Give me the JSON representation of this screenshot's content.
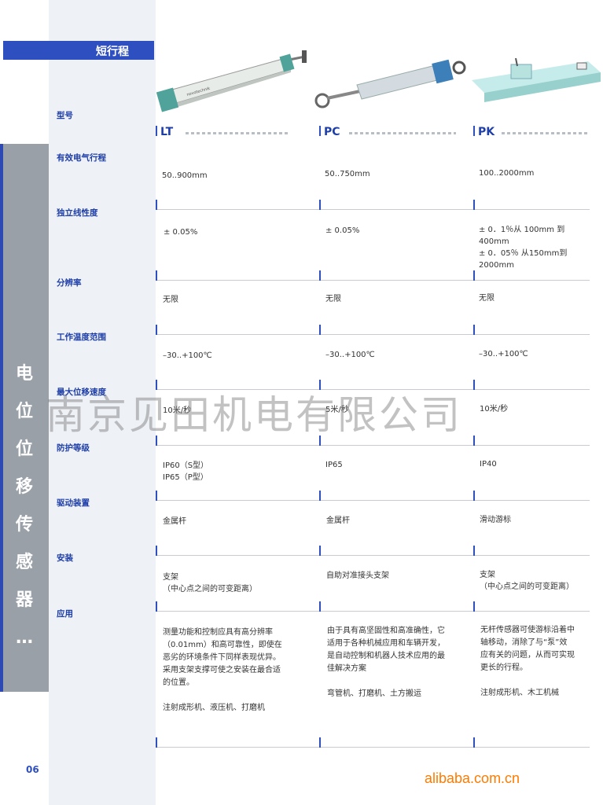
{
  "header": {
    "title": "短行程"
  },
  "sidebar": {
    "vertical_title": [
      "电",
      "位",
      "位",
      "移",
      "传",
      "感",
      "器",
      "…"
    ]
  },
  "columns": [
    {
      "name": "LT",
      "color": "#2e4fbf"
    },
    {
      "name": "PC",
      "color": "#2e4fbf"
    },
    {
      "name": "PK",
      "color": "#2e4fbf"
    }
  ],
  "rows": [
    {
      "label": "型号"
    },
    {
      "label": "有效电气行程",
      "values": [
        "50..900mm",
        "50..750mm",
        "100..2000mm"
      ]
    },
    {
      "label": "独立线性度",
      "values": [
        [
          "± 0.05%"
        ],
        [
          "± 0.05%"
        ],
        [
          "± 0．1％从  100mm  到",
          "400mm",
          "± 0．05％  从150mm到",
          "2000mm"
        ]
      ]
    },
    {
      "label": "分辨率",
      "values": [
        "无限",
        "无限",
        "无限"
      ]
    },
    {
      "label": "工作温度范围",
      "values": [
        "–30..+100℃",
        "–30..+100℃",
        "–30..+100℃"
      ]
    },
    {
      "label": "最大位移速度",
      "values": [
        "10米/秒",
        "5米/秒",
        "10米/秒"
      ]
    },
    {
      "label": "防护等级",
      "values": [
        [
          "IP60（S型）",
          "IP65（P型）"
        ],
        [
          "IP65"
        ],
        [
          "IP40"
        ]
      ]
    },
    {
      "label": "驱动装置",
      "values": [
        "金属杆",
        "金属杆",
        "滑动游标"
      ]
    },
    {
      "label": "安装",
      "values": [
        [
          "支架",
          "（中心点之间的可变距离）"
        ],
        [
          "自助对准接头支架"
        ],
        [
          "支架",
          "（中心点之间的可变距离）"
        ]
      ]
    },
    {
      "label": "应用",
      "values": [
        [
          "测量功能和控制应具有高分辨率",
          "（0.01mm）和高可靠性，即使在",
          "恶劣的环境条件下同样表现优异。",
          "采用支架支撑可使之安装在最合适",
          "的位置。",
          "",
          "注射成形机、液压机、打磨机"
        ],
        [
          "由于具有高坚固性和高准确性，它",
          "适用于各种机械应用和车辆开发，",
          "是自动控制和机器人技术应用的最",
          "佳解决方案",
          "",
          "弯管机、打磨机、土方搬运"
        ],
        [
          "无杆传感器可使游标沿着中",
          "轴移动，消除了与“泵”效",
          "应有关的问题，从而可实现",
          "更长的行程。",
          "",
          "注射成形机、木工机械"
        ]
      ]
    }
  ],
  "watermark": "南京见田机电有限公司",
  "page_number": "06",
  "site": "alibaba.com.cn"
}
